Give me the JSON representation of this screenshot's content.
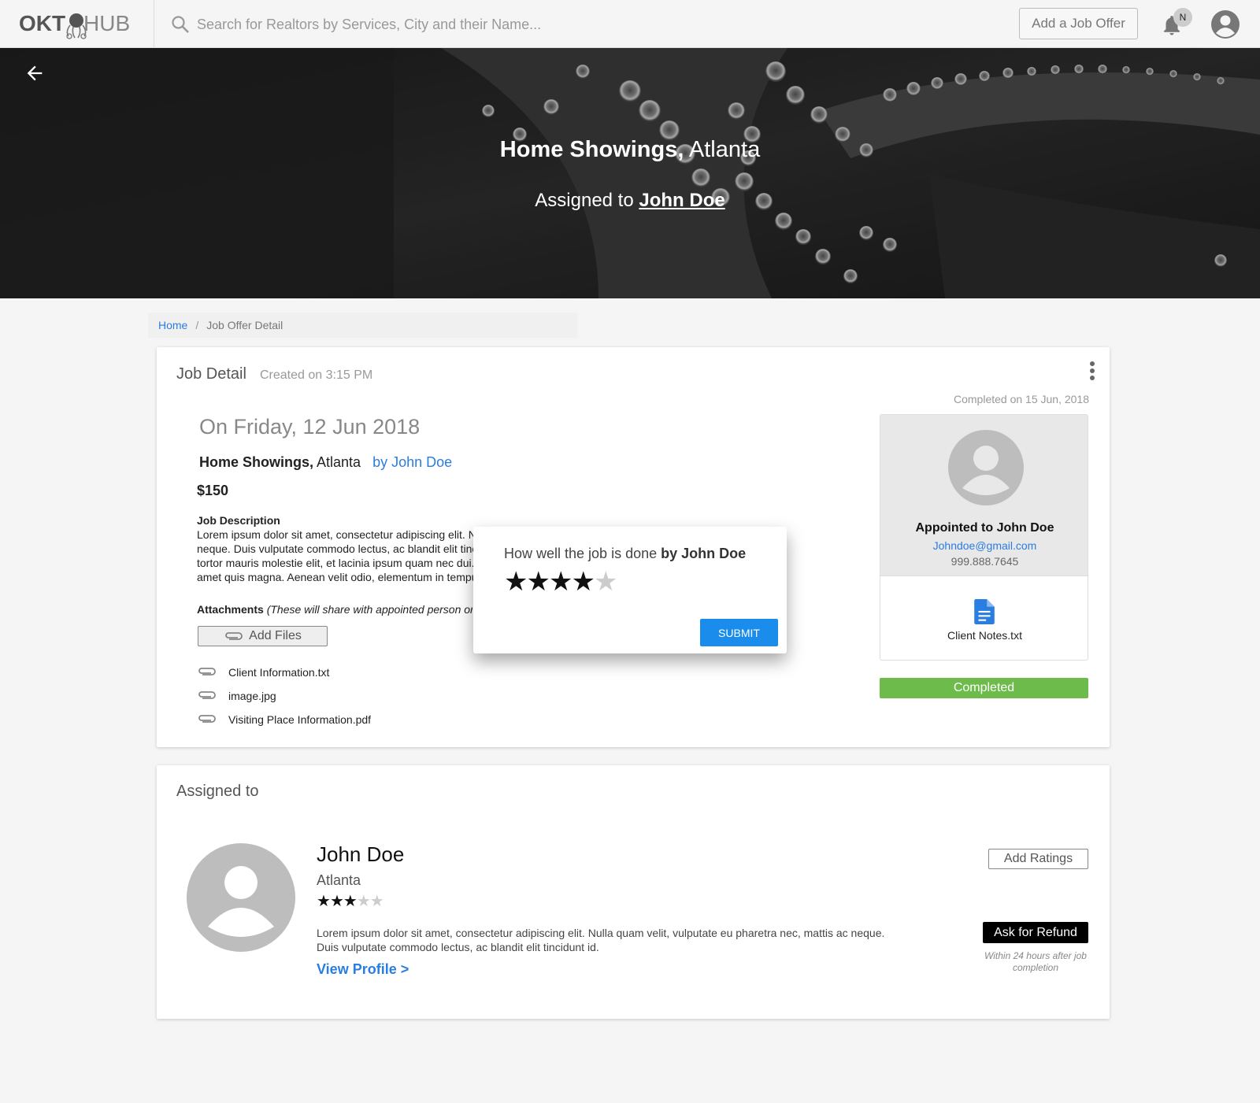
{
  "header": {
    "logo_prefix": "OKT",
    "logo_suffix": "HUB",
    "search_placeholder": "Search for Realtors by Services, City and their Name...",
    "add_job_label": "Add a Job Offer",
    "notification_badge": "N"
  },
  "hero": {
    "service": "Home Showings,",
    "city": "Atlanta",
    "assigned_prefix": "Assigned to",
    "assigned_name": "John Doe"
  },
  "breadcrumb": {
    "home": "Home",
    "separator": "/",
    "current": "Job Offer Detail"
  },
  "job_detail": {
    "title": "Job Detail",
    "created": "Created on 3:15 PM",
    "completed_date": "Completed on 15 Jun, 2018",
    "date_heading": "On Friday, 12 Jun 2018",
    "service": "Home Showings,",
    "city": "Atlanta",
    "by": "by John Doe",
    "price": "$150",
    "description_title": "Job Description",
    "description_lines": [
      "Lorem ipsum dolor sit amet, consectetur adipiscing elit. N",
      "neque. Duis vulputate commodo lectus, ac blandit elit tinc",
      "tortor mauris molestie elit, et lacinia ipsum quam nec dui.",
      "amet quis magna. Aenean velit odio, elementum in tempu"
    ],
    "attachments_title": "Attachments",
    "attachments_note": "(These will share with appointed person or",
    "add_files_label": "Add Files",
    "files": [
      "Client Information.txt",
      "image.jpg",
      "Visiting Place Information.pdf"
    ]
  },
  "agent_box": {
    "appointed": "Appointed to John Doe",
    "email": "Johndoe@gmail.com",
    "phone": "999.888.7645",
    "note_file": "Client Notes.txt",
    "status": "Completed",
    "status_color": "#6dbb4a"
  },
  "rating_dialog": {
    "question": "How well the job is done",
    "question_name": "by John Doe",
    "rating": 4,
    "max_rating": 5,
    "submit_label": "SUBMIT"
  },
  "assigned": {
    "title": "Assigned to",
    "name": "John Doe",
    "city": "Atlanta",
    "rating": 3,
    "max_rating": 5,
    "description_line1": "Lorem ipsum dolor sit amet, consectetur adipiscing elit. Nulla quam velit, vulputate eu pharetra nec, mattis ac neque.",
    "description_line2": "Duis vulputate commodo lectus, ac blandit elit tincidunt id.",
    "view_profile": "View Profile >",
    "add_ratings_label": "Add Ratings",
    "refund_label": "Ask for Refund",
    "refund_note": "Within 24 hours after job completion"
  },
  "colors": {
    "accent": "#2a7de1",
    "submit": "#1a8cec"
  }
}
